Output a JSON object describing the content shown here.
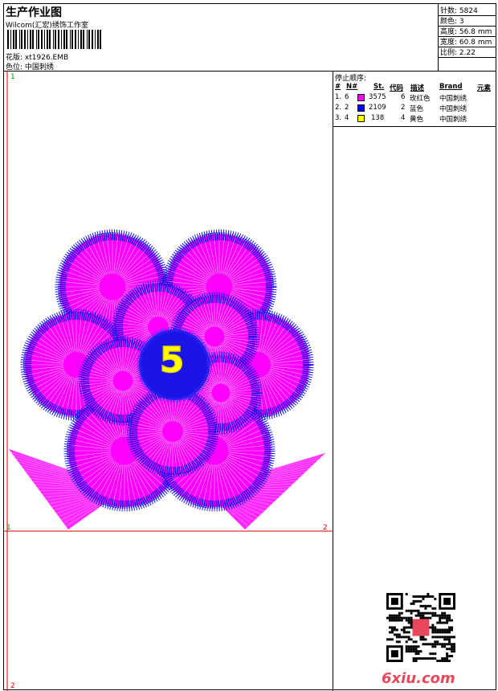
{
  "header": {
    "title": "生产作业图",
    "subtitle": "Wilcom(汇宏)绣饰工作室",
    "design_label": "花版:",
    "design_value": "xt1926.EMB",
    "color_label": "色位:",
    "color_value": "中国刺绣"
  },
  "stats": [
    {
      "label": "针数:",
      "value": "5824"
    },
    {
      "label": "颜色:",
      "value": "3"
    },
    {
      "label": "高度:",
      "value": "56.8 mm"
    },
    {
      "label": "宽度:",
      "value": "60.8 mm"
    },
    {
      "label": "比例:",
      "value": "2.22"
    }
  ],
  "stop_sequence": {
    "title": "停止顺序:",
    "columns": [
      "#",
      "N#",
      "St.",
      "代码",
      "描述",
      "Brand",
      "元素"
    ],
    "rows": [
      {
        "num": "1.",
        "n": "6",
        "color": "#ff00ff",
        "stitches": "3575",
        "code": "6",
        "desc": "玫红色",
        "brand": "中国刺绣",
        "element": ""
      },
      {
        "num": "2.",
        "n": "2",
        "color": "#0000ff",
        "stitches": "2109",
        "code": "2",
        "desc": "蓝色",
        "brand": "中国刺绣",
        "element": ""
      },
      {
        "num": "3.",
        "n": "4",
        "color": "#ffff00",
        "stitches": "138",
        "code": "4",
        "desc": "黄色",
        "brand": "中国刺绣",
        "element": ""
      }
    ]
  },
  "guides": {
    "marker_top_left": "1",
    "marker_mid_left": "1",
    "marker_mid_right": "2",
    "marker_bottom_left": "2"
  },
  "colors": {
    "magenta": "#ff00ff",
    "blue": "#1a14e6",
    "yellow": "#ffff00",
    "guide_red": "#d00000",
    "guide_green": "#00a000"
  },
  "artwork": {
    "center_text": "5",
    "icon": "embroidery-flower"
  },
  "footer": {
    "watermark": "6xiu.com",
    "qr_icon": "qr-code-icon"
  }
}
